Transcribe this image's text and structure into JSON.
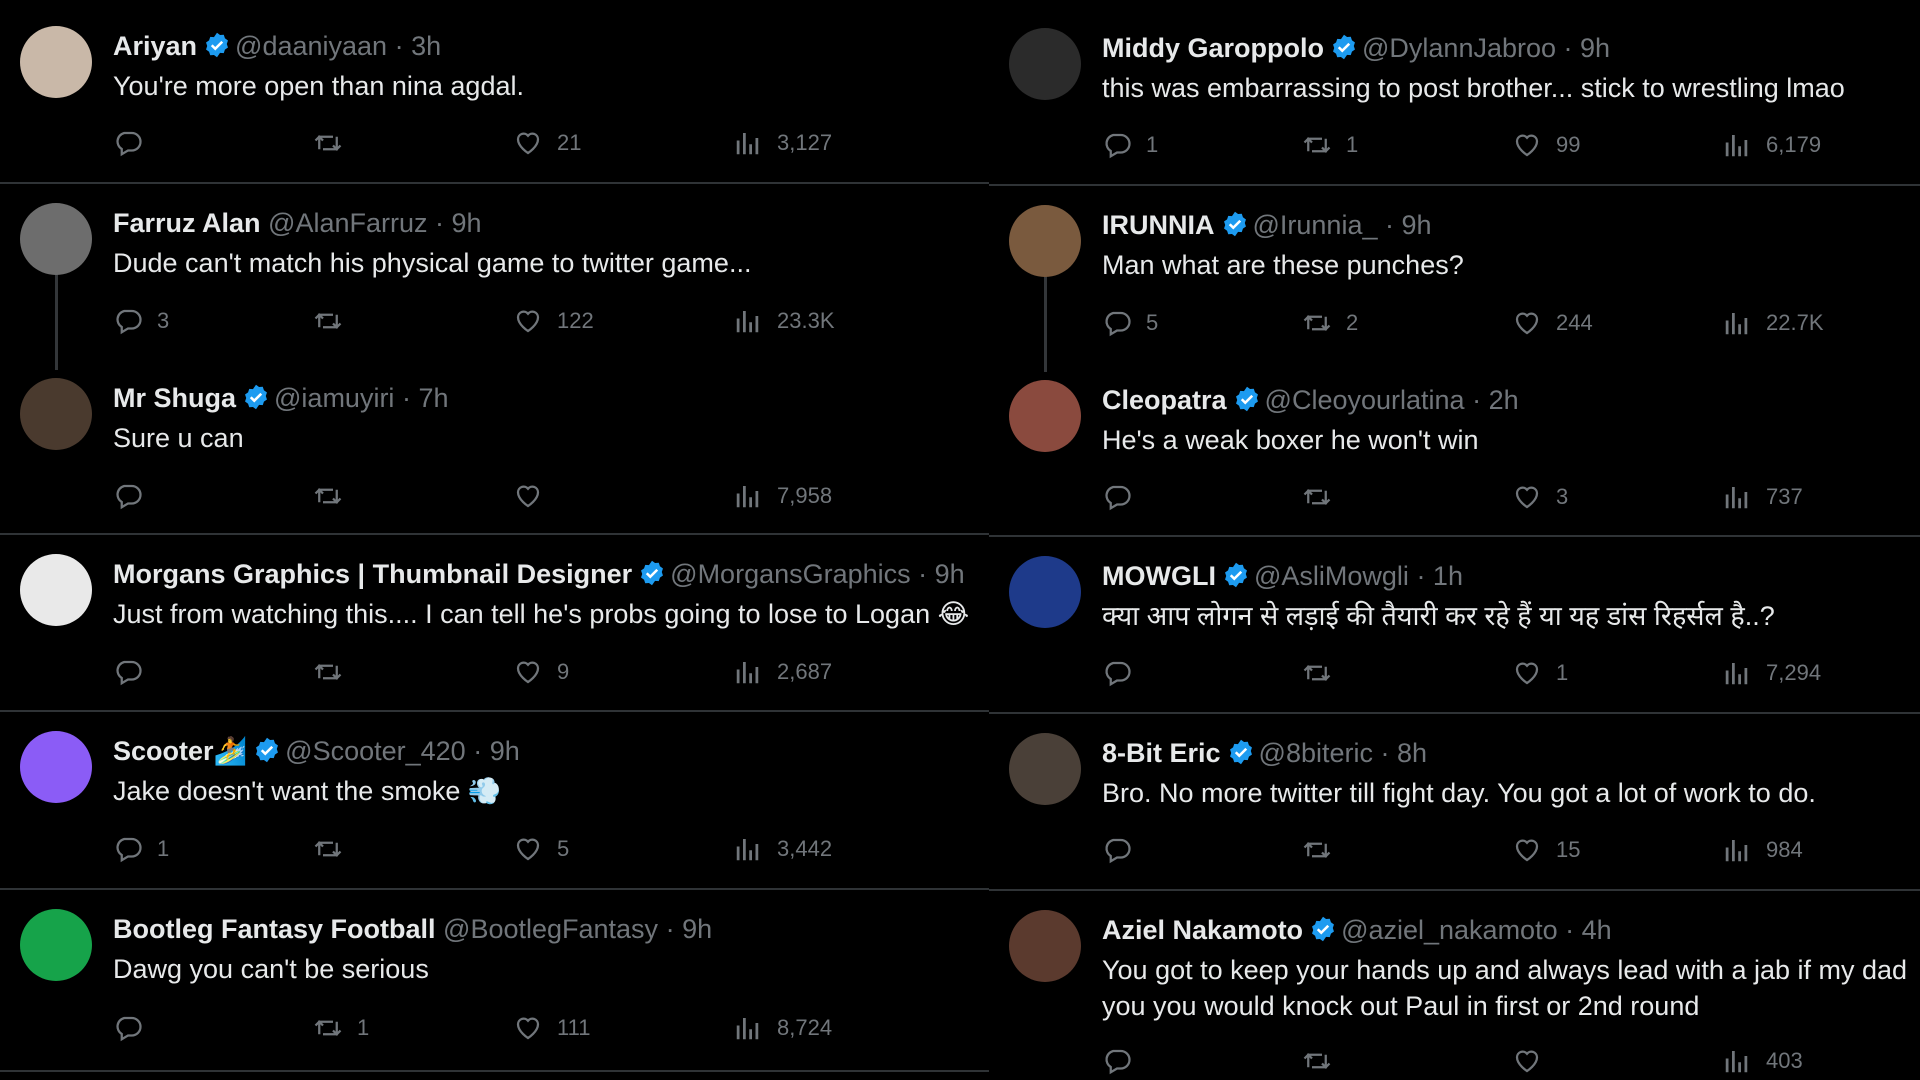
{
  "colors": {
    "background": "#000000",
    "text": "#e7e9ea",
    "muted": "#71767b",
    "verified": "#1d9bf0",
    "divider": "#2f3336"
  },
  "left": [
    {
      "name": "Ariyan",
      "verified": true,
      "handle": "@daaniyaan",
      "time": "· 3h",
      "text": "You're more open than nina agdal.",
      "replies": "",
      "retweets": "",
      "likes": "21",
      "views": "3,127"
    },
    {
      "name": "Farruz Alan",
      "verified": false,
      "handle": "@AlanFarruz",
      "time": "· 9h",
      "text": "Dude can't match his physical game to twitter game...",
      "replies": "3",
      "retweets": "",
      "likes": "122",
      "views": "23.3K"
    },
    {
      "name": "Mr Shuga",
      "verified": true,
      "handle": "@iamuyiri",
      "time": "· 7h",
      "text": "Sure u can",
      "replies": "",
      "retweets": "",
      "likes": "",
      "views": "7,958"
    },
    {
      "name": "Morgans Graphics | Thumbnail Designer",
      "verified": true,
      "handle": "@MorgansGraphics",
      "time": "· 9h",
      "text": "Just from watching this....  I can tell he's probs going to lose to Logan 😂",
      "replies": "",
      "retweets": "",
      "likes": "9",
      "views": "2,687"
    },
    {
      "name": "Scooter🏄",
      "verified": true,
      "handle": "@Scooter_420",
      "time": "· 9h",
      "text": "Jake doesn't want the smoke 💨",
      "replies": "1",
      "retweets": "",
      "likes": "5",
      "views": "3,442"
    },
    {
      "name": "Bootleg Fantasy Football",
      "verified": false,
      "handle": "@BootlegFantasy",
      "time": "· 9h",
      "text": "Dawg you can't be serious",
      "replies": "",
      "retweets": "1",
      "likes": "111",
      "views": "8,724"
    }
  ],
  "right": [
    {
      "name": "Middy Garoppolo",
      "verified": true,
      "handle": "@DylannJabroo",
      "time": "· 9h",
      "text": "this was embarrassing to post brother... stick to wrestling lmao",
      "replies": "1",
      "retweets": "1",
      "likes": "99",
      "views": "6,179"
    },
    {
      "name": "IRUNNIA",
      "verified": true,
      "handle": "@Irunnia_",
      "time": "· 9h",
      "text": "Man what are these punches?",
      "replies": "5",
      "retweets": "2",
      "likes": "244",
      "views": "22.7K"
    },
    {
      "name": "Cleopatra",
      "verified": true,
      "handle": "@Cleoyourlatina",
      "time": "· 2h",
      "text": "He's a weak boxer he won't win",
      "replies": "",
      "retweets": "",
      "likes": "3",
      "views": "737"
    },
    {
      "name": "MOWGLI",
      "verified": true,
      "handle": "@AsliMowgli",
      "time": "· 1h",
      "text": "क्या आप लोगन से लड़ाई की तैयारी कर रहे हैं या यह डांस रिहर्सल है..?",
      "replies": "",
      "retweets": "",
      "likes": "1",
      "views": "7,294"
    },
    {
      "name": "8-Bit Eric",
      "verified": true,
      "handle": "@8biteric",
      "time": "· 8h",
      "text": "Bro. No more twitter till fight day. You got a lot of work to do.",
      "replies": "",
      "retweets": "",
      "likes": "15",
      "views": "984"
    },
    {
      "name": "Aziel Nakamoto",
      "verified": true,
      "handle": "@aziel_nakamoto",
      "time": "· 4h",
      "text": "You got to keep your hands up and always lead with a jab if my dad",
      "text2": "you you would knock out Paul in first or 2nd round",
      "replies": "",
      "retweets": "",
      "likes": "",
      "views": "403"
    }
  ]
}
